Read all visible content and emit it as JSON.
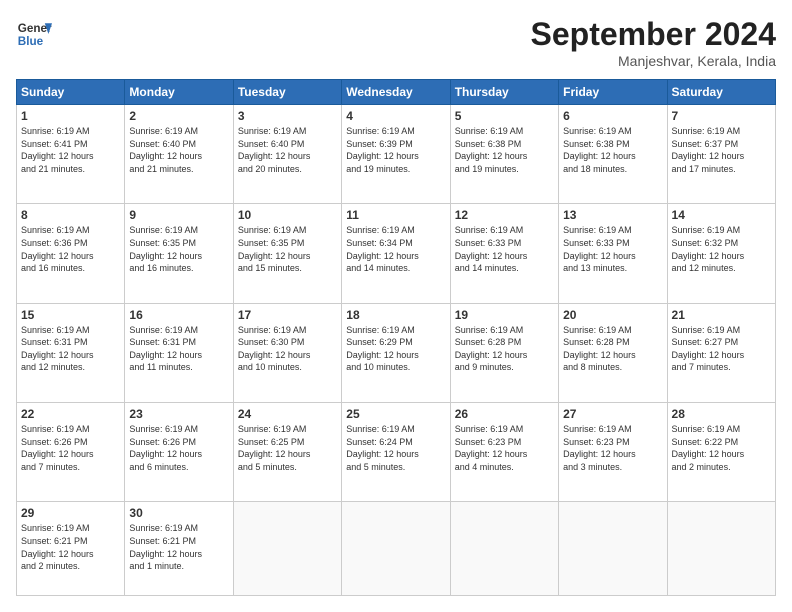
{
  "header": {
    "logo_line1": "General",
    "logo_line2": "Blue",
    "month": "September 2024",
    "location": "Manjeshvar, Kerala, India"
  },
  "weekdays": [
    "Sunday",
    "Monday",
    "Tuesday",
    "Wednesday",
    "Thursday",
    "Friday",
    "Saturday"
  ],
  "weeks": [
    [
      {
        "day": "1",
        "info": "Sunrise: 6:19 AM\nSunset: 6:41 PM\nDaylight: 12 hours\nand 21 minutes."
      },
      {
        "day": "2",
        "info": "Sunrise: 6:19 AM\nSunset: 6:40 PM\nDaylight: 12 hours\nand 21 minutes."
      },
      {
        "day": "3",
        "info": "Sunrise: 6:19 AM\nSunset: 6:40 PM\nDaylight: 12 hours\nand 20 minutes."
      },
      {
        "day": "4",
        "info": "Sunrise: 6:19 AM\nSunset: 6:39 PM\nDaylight: 12 hours\nand 19 minutes."
      },
      {
        "day": "5",
        "info": "Sunrise: 6:19 AM\nSunset: 6:38 PM\nDaylight: 12 hours\nand 19 minutes."
      },
      {
        "day": "6",
        "info": "Sunrise: 6:19 AM\nSunset: 6:38 PM\nDaylight: 12 hours\nand 18 minutes."
      },
      {
        "day": "7",
        "info": "Sunrise: 6:19 AM\nSunset: 6:37 PM\nDaylight: 12 hours\nand 17 minutes."
      }
    ],
    [
      {
        "day": "8",
        "info": "Sunrise: 6:19 AM\nSunset: 6:36 PM\nDaylight: 12 hours\nand 16 minutes."
      },
      {
        "day": "9",
        "info": "Sunrise: 6:19 AM\nSunset: 6:35 PM\nDaylight: 12 hours\nand 16 minutes."
      },
      {
        "day": "10",
        "info": "Sunrise: 6:19 AM\nSunset: 6:35 PM\nDaylight: 12 hours\nand 15 minutes."
      },
      {
        "day": "11",
        "info": "Sunrise: 6:19 AM\nSunset: 6:34 PM\nDaylight: 12 hours\nand 14 minutes."
      },
      {
        "day": "12",
        "info": "Sunrise: 6:19 AM\nSunset: 6:33 PM\nDaylight: 12 hours\nand 14 minutes."
      },
      {
        "day": "13",
        "info": "Sunrise: 6:19 AM\nSunset: 6:33 PM\nDaylight: 12 hours\nand 13 minutes."
      },
      {
        "day": "14",
        "info": "Sunrise: 6:19 AM\nSunset: 6:32 PM\nDaylight: 12 hours\nand 12 minutes."
      }
    ],
    [
      {
        "day": "15",
        "info": "Sunrise: 6:19 AM\nSunset: 6:31 PM\nDaylight: 12 hours\nand 12 minutes."
      },
      {
        "day": "16",
        "info": "Sunrise: 6:19 AM\nSunset: 6:31 PM\nDaylight: 12 hours\nand 11 minutes."
      },
      {
        "day": "17",
        "info": "Sunrise: 6:19 AM\nSunset: 6:30 PM\nDaylight: 12 hours\nand 10 minutes."
      },
      {
        "day": "18",
        "info": "Sunrise: 6:19 AM\nSunset: 6:29 PM\nDaylight: 12 hours\nand 10 minutes."
      },
      {
        "day": "19",
        "info": "Sunrise: 6:19 AM\nSunset: 6:28 PM\nDaylight: 12 hours\nand 9 minutes."
      },
      {
        "day": "20",
        "info": "Sunrise: 6:19 AM\nSunset: 6:28 PM\nDaylight: 12 hours\nand 8 minutes."
      },
      {
        "day": "21",
        "info": "Sunrise: 6:19 AM\nSunset: 6:27 PM\nDaylight: 12 hours\nand 7 minutes."
      }
    ],
    [
      {
        "day": "22",
        "info": "Sunrise: 6:19 AM\nSunset: 6:26 PM\nDaylight: 12 hours\nand 7 minutes."
      },
      {
        "day": "23",
        "info": "Sunrise: 6:19 AM\nSunset: 6:26 PM\nDaylight: 12 hours\nand 6 minutes."
      },
      {
        "day": "24",
        "info": "Sunrise: 6:19 AM\nSunset: 6:25 PM\nDaylight: 12 hours\nand 5 minutes."
      },
      {
        "day": "25",
        "info": "Sunrise: 6:19 AM\nSunset: 6:24 PM\nDaylight: 12 hours\nand 5 minutes."
      },
      {
        "day": "26",
        "info": "Sunrise: 6:19 AM\nSunset: 6:23 PM\nDaylight: 12 hours\nand 4 minutes."
      },
      {
        "day": "27",
        "info": "Sunrise: 6:19 AM\nSunset: 6:23 PM\nDaylight: 12 hours\nand 3 minutes."
      },
      {
        "day": "28",
        "info": "Sunrise: 6:19 AM\nSunset: 6:22 PM\nDaylight: 12 hours\nand 2 minutes."
      }
    ],
    [
      {
        "day": "29",
        "info": "Sunrise: 6:19 AM\nSunset: 6:21 PM\nDaylight: 12 hours\nand 2 minutes."
      },
      {
        "day": "30",
        "info": "Sunrise: 6:19 AM\nSunset: 6:21 PM\nDaylight: 12 hours\nand 1 minute."
      },
      {
        "day": "",
        "info": ""
      },
      {
        "day": "",
        "info": ""
      },
      {
        "day": "",
        "info": ""
      },
      {
        "day": "",
        "info": ""
      },
      {
        "day": "",
        "info": ""
      }
    ]
  ]
}
